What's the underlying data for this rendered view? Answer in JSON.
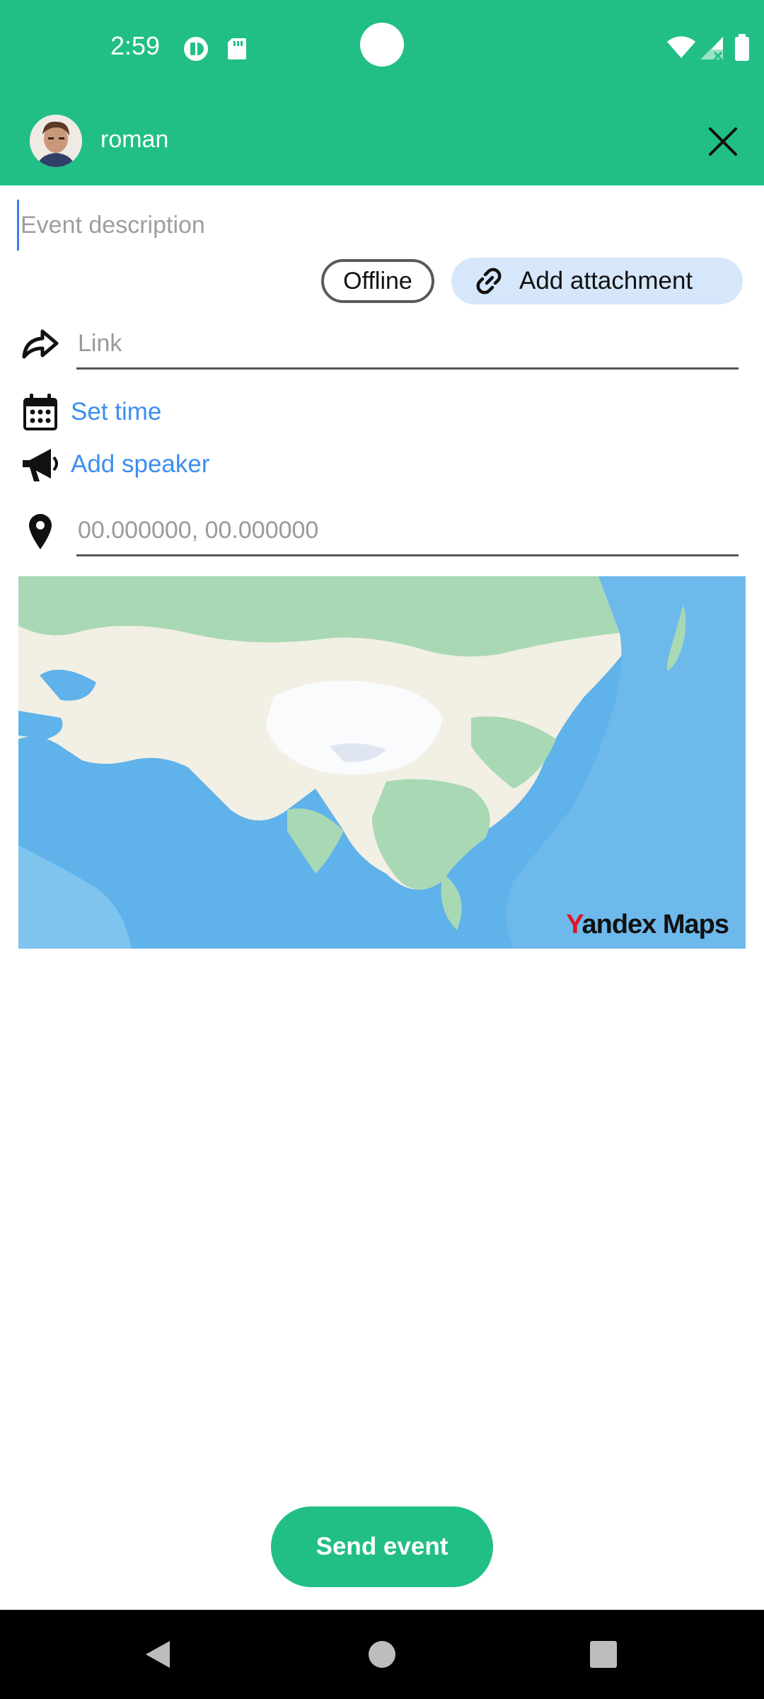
{
  "status_bar": {
    "time": "2:59",
    "left_icons": [
      "sync-app-icon",
      "sd-card-icon"
    ],
    "right_icons": [
      "wifi-icon",
      "cell-signal-icon",
      "battery-icon"
    ]
  },
  "header": {
    "username": "roman",
    "avatar_icon": "avatar",
    "close_icon": "close-icon",
    "background_color": "#21bf85"
  },
  "form": {
    "description_placeholder": "Event description",
    "offline_label": "Offline",
    "attachment_label": "Add attachment",
    "link_placeholder": "Link",
    "set_time_label": "Set time",
    "add_speaker_label": "Add speaker",
    "coordinates_placeholder": "00.000000, 00.000000",
    "accent_color": "#3d8ef0"
  },
  "map": {
    "brand_first_letter": "Y",
    "brand_rest": "andex Maps"
  },
  "send_button_label": "Send event",
  "nav": [
    "back-icon",
    "home-icon",
    "recents-icon"
  ]
}
